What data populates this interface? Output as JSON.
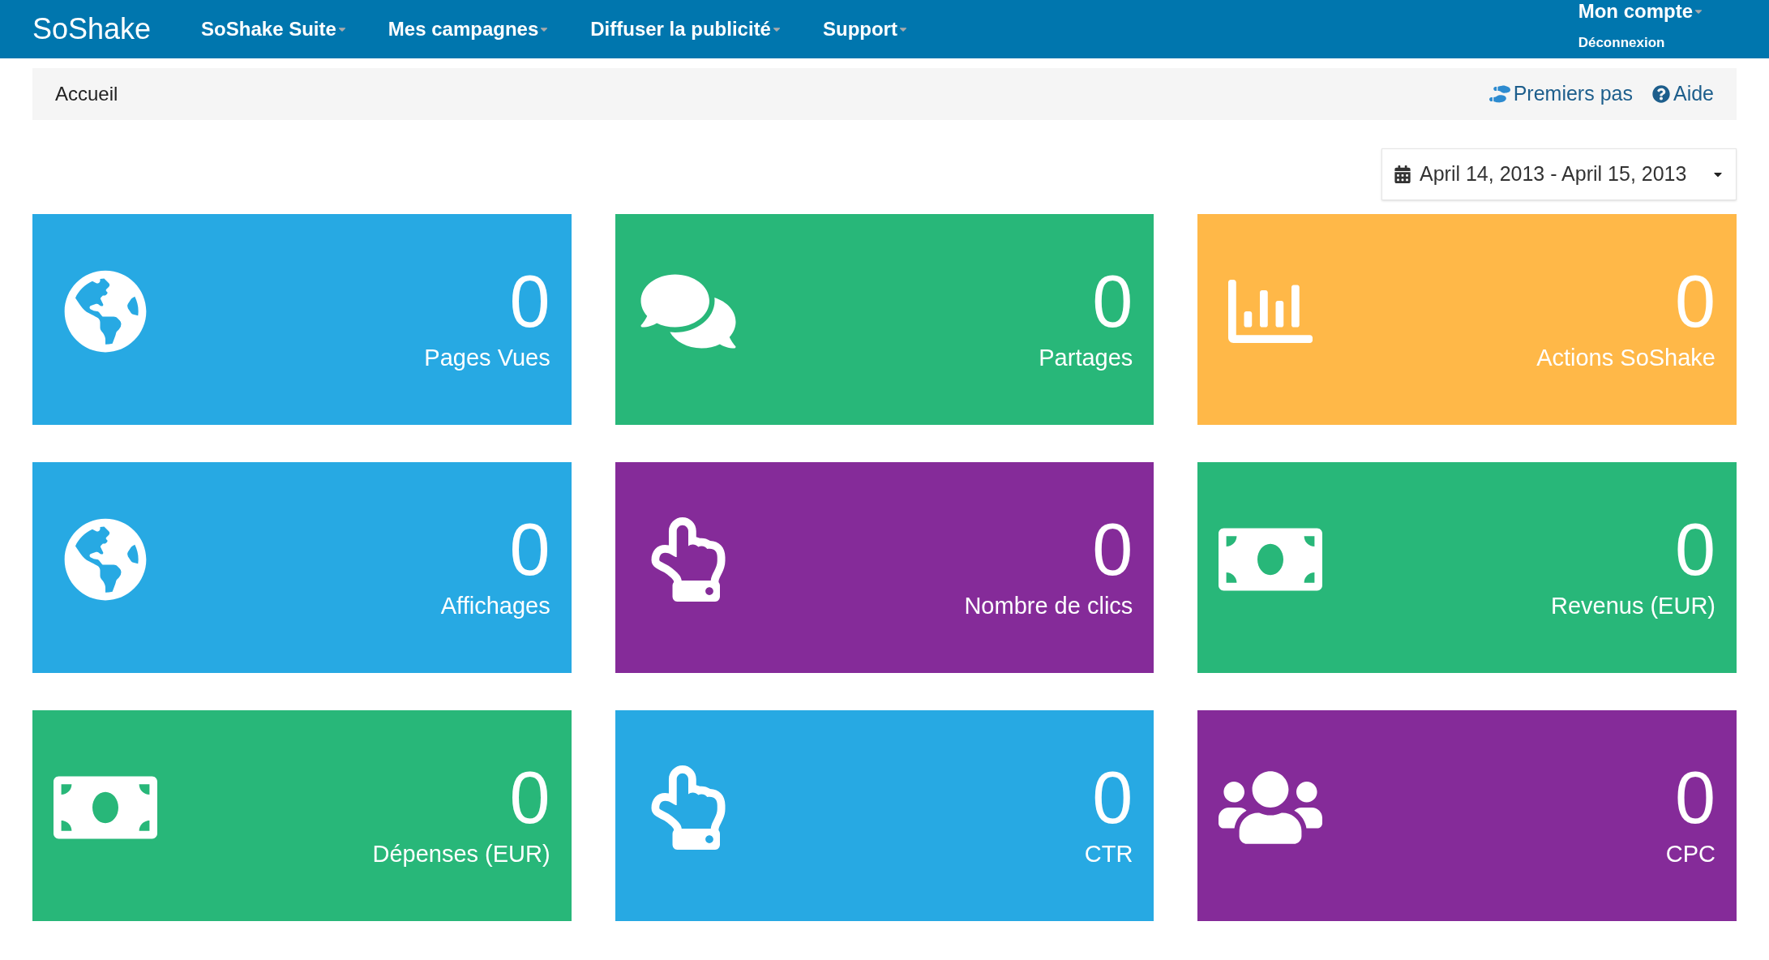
{
  "navbar": {
    "brand": "SoShake",
    "menus": [
      {
        "label": "SoShake Suite"
      },
      {
        "label": "Mes campagnes"
      },
      {
        "label": "Diffuser la publicité"
      },
      {
        "label": "Support"
      }
    ],
    "account": {
      "label": "Mon compte",
      "logout": "Déconnexion"
    }
  },
  "breadcrumb": {
    "current": "Accueil",
    "links": [
      {
        "kind": "steps",
        "label": "Premiers pas"
      },
      {
        "kind": "help",
        "label": "Aide"
      }
    ]
  },
  "date_range": {
    "value": "April 14, 2013 - April 15, 2013"
  },
  "tiles": [
    {
      "kind": "globe",
      "color": "#27a9e3",
      "value": "0",
      "label": "Pages Vues"
    },
    {
      "kind": "comments",
      "color": "#28b779",
      "value": "0",
      "label": "Partages"
    },
    {
      "kind": "chart",
      "color": "#ffb848",
      "value": "0",
      "label": "Actions SoShake"
    },
    {
      "kind": "globe",
      "color": "#27a9e3",
      "value": "0",
      "label": "Affichages"
    },
    {
      "kind": "pointer",
      "color": "#852b99",
      "value": "0",
      "label": "Nombre de clics"
    },
    {
      "kind": "money",
      "color": "#28b779",
      "value": "0",
      "label": "Revenus (EUR)"
    },
    {
      "kind": "money",
      "color": "#28b779",
      "value": "0",
      "label": "Dépenses (EUR)"
    },
    {
      "kind": "pointer",
      "color": "#27a9e3",
      "value": "0",
      "label": "CTR"
    },
    {
      "kind": "users",
      "color": "#852b99",
      "value": "0",
      "label": "CPC"
    }
  ]
}
